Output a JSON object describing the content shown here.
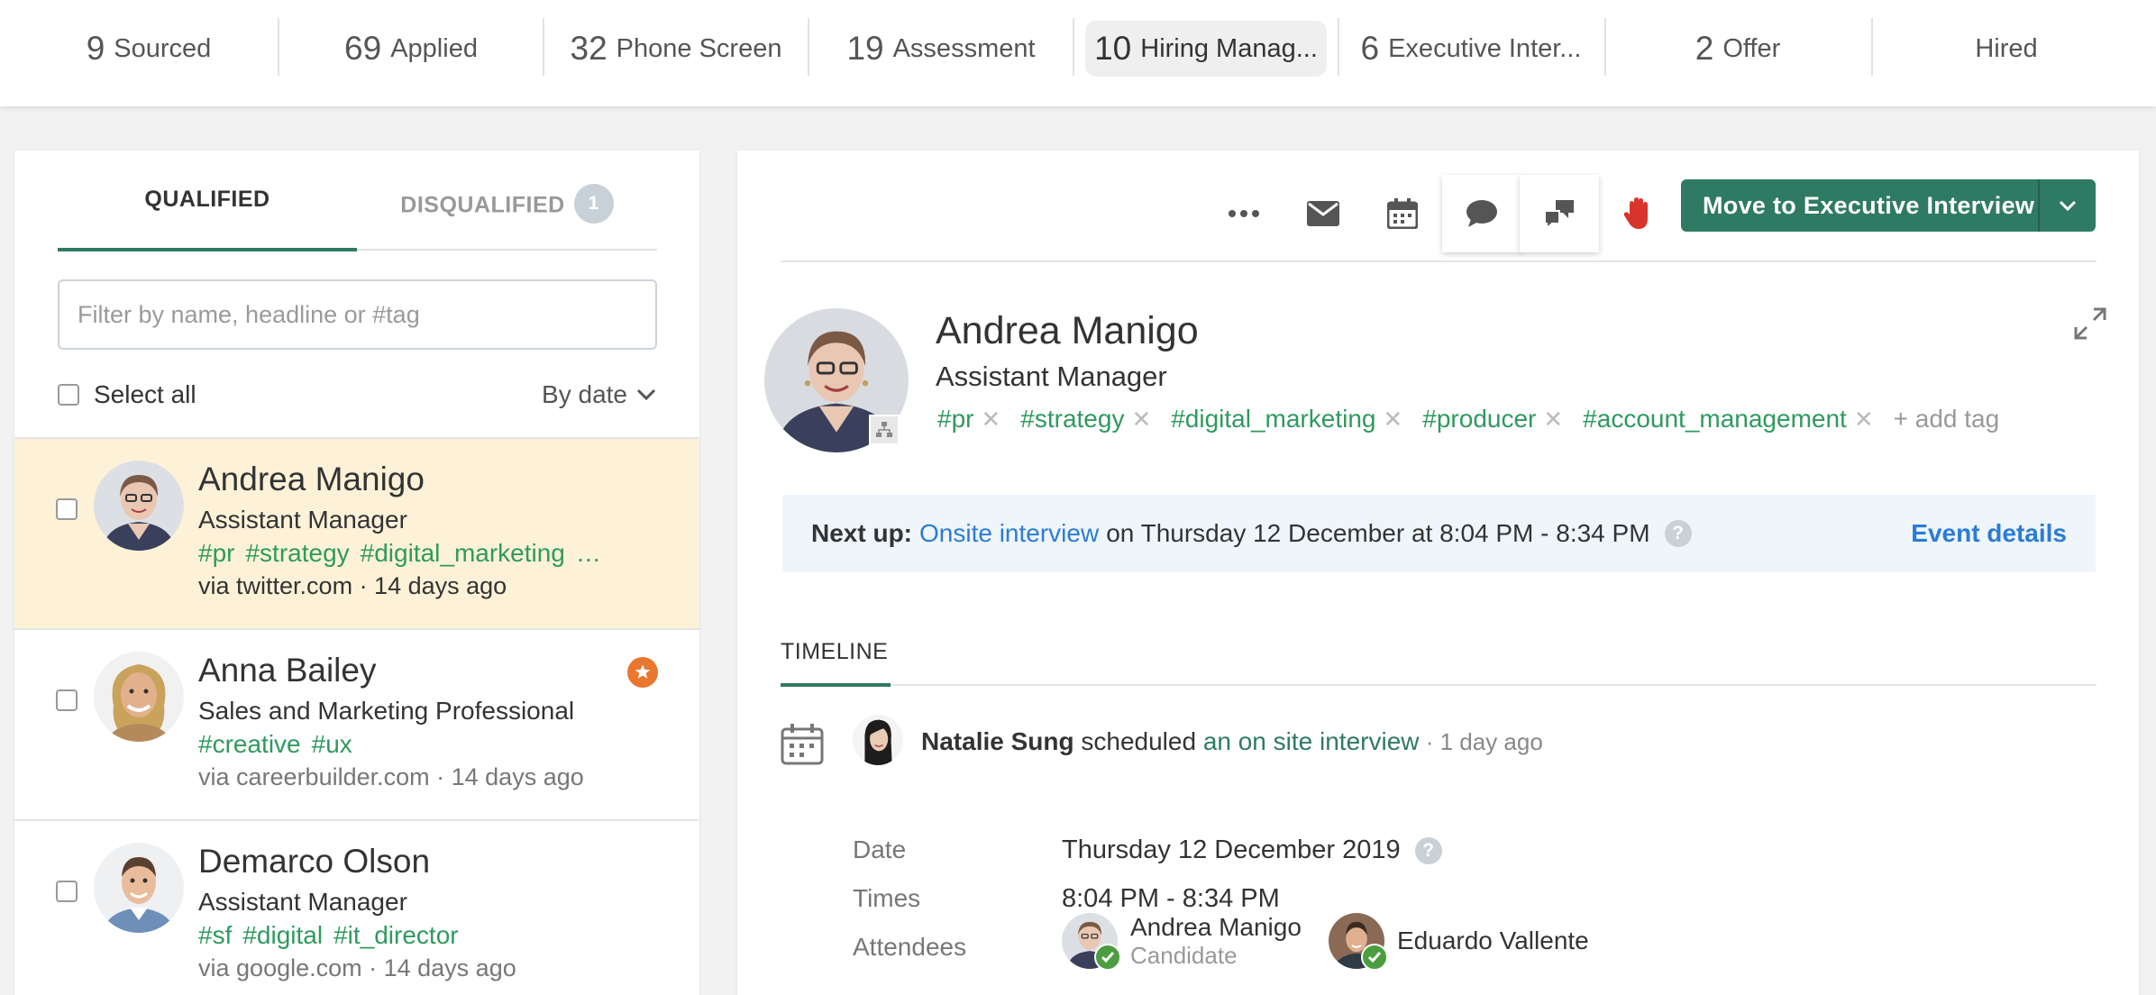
{
  "pipeline": {
    "stages": [
      {
        "count": "9",
        "label": "Sourced"
      },
      {
        "count": "69",
        "label": "Applied"
      },
      {
        "count": "32",
        "label": "Phone Screen"
      },
      {
        "count": "19",
        "label": "Assessment"
      },
      {
        "count": "10",
        "label": "Hiring Manag..."
      },
      {
        "count": "6",
        "label": "Executive Inter..."
      },
      {
        "count": "2",
        "label": "Offer"
      },
      {
        "count": "",
        "label": "Hired"
      }
    ],
    "active_stage": "Hiring Manag..."
  },
  "left": {
    "tabs": {
      "qualified": "QUALIFIED",
      "disqualified": "DISQUALIFIED",
      "disqualified_count": "1"
    },
    "filter_placeholder": "Filter by name, headline or #tag",
    "select_all": "Select all",
    "sort": "By date",
    "candidates": [
      {
        "name": "Andrea Manigo",
        "headline": "Assistant Manager",
        "tags": [
          "#pr",
          "#strategy",
          "#digital_marketing",
          "…"
        ],
        "via_prefix": "via ",
        "source": "twitter.com",
        "ago": " · 14 days ago",
        "selected": true
      },
      {
        "name": "Anna Bailey",
        "headline": "Sales and Marketing Professional",
        "tags": [
          "#creative",
          "#ux"
        ],
        "via_prefix": "via ",
        "source": "careerbuilder.com",
        "ago": " · 14 days ago",
        "starred": true
      },
      {
        "name": "Demarco Olson",
        "headline": "Assistant Manager",
        "tags": [
          "#sf",
          "#digital",
          "#it_director"
        ],
        "via_prefix": "via ",
        "source": "google.com",
        "ago": " · 14 days ago"
      }
    ]
  },
  "toolbar": {
    "icons": [
      "more-icon",
      "mail-icon",
      "calendar-icon",
      "comment-icon",
      "feedback-icon",
      "disqualify-hand-icon"
    ],
    "move_button": "Move to Executive Interview"
  },
  "profile": {
    "name": "Andrea Manigo",
    "headline": "Assistant Manager",
    "tags": [
      "#pr",
      "#strategy",
      "#digital_marketing",
      "#producer",
      "#account_management"
    ],
    "add_tag": "+ add tag"
  },
  "next_up": {
    "label": "Next up:",
    "event_link": "Onsite interview",
    "text": "on Thursday 12 December at 8:04 PM - 8:34 PM",
    "details": "Event details"
  },
  "timeline": {
    "title": "TIMELINE",
    "entry": {
      "who": "Natalie Sung",
      "verb": " scheduled ",
      "what": "an on site interview",
      "ago": " · 1 day ago",
      "date_label": "Date",
      "date_value": "Thursday 12 December 2019",
      "times_label": "Times",
      "times_value": "8:04 PM - 8:34 PM",
      "attendees_label": "Attendees",
      "attendees": [
        {
          "name": "Andrea Manigo",
          "role": "Candidate"
        },
        {
          "name": "Eduardo Vallente",
          "role": ""
        }
      ]
    }
  },
  "colors": {
    "accent": "#2f7a63",
    "tag": "#2f9a5e",
    "link": "#2c7bd6",
    "selected_row": "#fdf2d8",
    "star": "#e9772e",
    "hand": "#d9342b"
  }
}
